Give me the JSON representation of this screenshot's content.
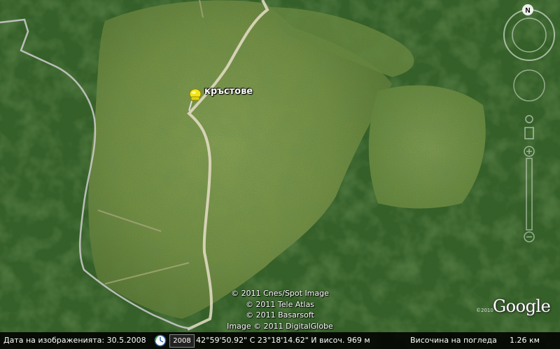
{
  "map": {
    "placemark": {
      "label": "кръстове",
      "icon": "yellow-pushpin-icon",
      "color": "#f2e51b"
    },
    "copyright": [
      "© 2011 Cnes/Spot Image",
      "© 2011 Tele Atlas",
      "© 2011 Basarsoft",
      "Image © 2011 DigitalGlobe"
    ],
    "logo": {
      "text": "Google",
      "year": "©2010"
    },
    "compass": {
      "north_label": "N"
    },
    "colors": {
      "meadow": "#7c9a4a",
      "forest": "#2f5a22",
      "road": "#e8e2cf",
      "border": "#c9c9c9"
    }
  },
  "status": {
    "date_label": "Дата на изображенията: 30.5.2008",
    "year_box": "2008",
    "coords": "42°59'50.92\" С   23°18'14.62\" И",
    "elevation": "височ.  969 м",
    "eye_label": "Височина на погледа",
    "eye_value": "1.26 км"
  }
}
